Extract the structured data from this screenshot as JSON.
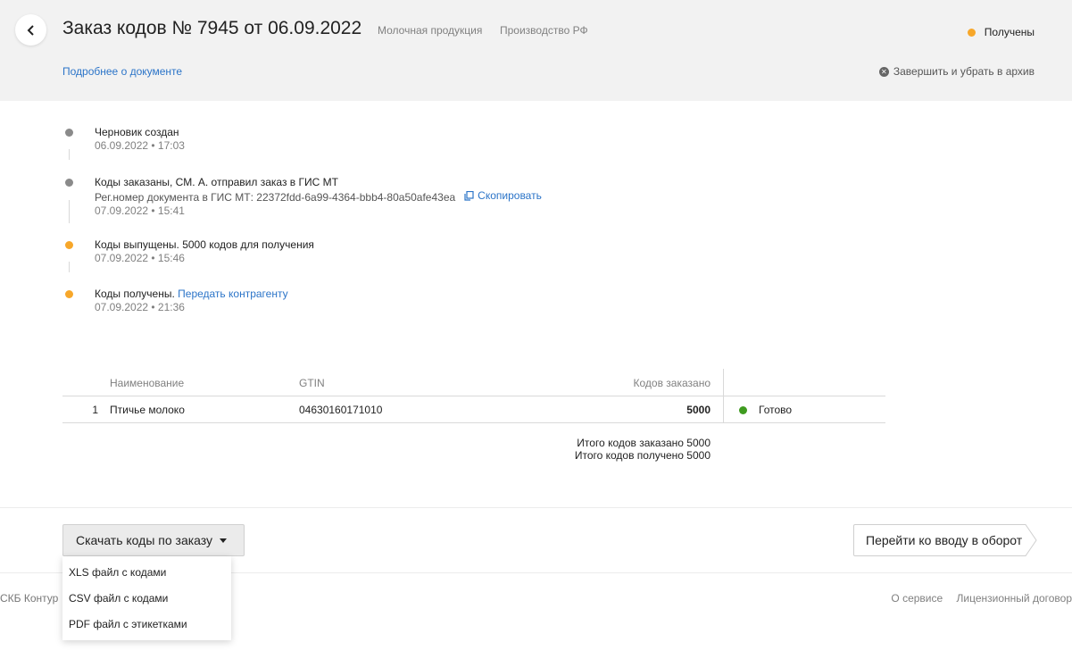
{
  "header": {
    "title": "Заказ кодов № 7945 от 06.09.2022",
    "tags": [
      "Молочная продукция",
      "Производство РФ"
    ],
    "status": "Получены",
    "status_color": "#f7a72a",
    "details_link": "Подробнее о документе",
    "archive_action": "Завершить и убрать в архив"
  },
  "timeline": [
    {
      "title": "Черновик создан",
      "time": "06.09.2022 • 17:03",
      "color": "#8a8a8a"
    },
    {
      "title": "Коды заказаны, СМ. А. отправил заказ в ГИС МТ",
      "sub": "Рег.номер документа в ГИС МТ: 22372fdd-6a99-4364-bbb4-80a50afe43ea",
      "copy_label": "Скопировать",
      "time": "07.09.2022 • 15:41",
      "color": "#8a8a8a"
    },
    {
      "title": "Коды выпущены. 5000 кодов для получения",
      "time": "07.09.2022 • 15:46",
      "color": "#f7a72a"
    },
    {
      "title": "Коды получены.",
      "link": "Передать контрагенту",
      "time": "07.09.2022 • 21:36",
      "color": "#f7a72a"
    }
  ],
  "table": {
    "headers": {
      "name": "Наименование",
      "gtin": "GTIN",
      "count": "Кодов заказано"
    },
    "rows": [
      {
        "num": "1",
        "name": "Птичье молоко",
        "gtin": "04630160171010",
        "count": "5000",
        "status": "Готово",
        "status_color": "#3f9b20"
      }
    ]
  },
  "totals": {
    "ordered_label": "Итого кодов заказано",
    "ordered_value": "5000",
    "received_label": "Итого кодов получено",
    "received_value": "5000"
  },
  "actions": {
    "download_label": "Скачать коды по заказу",
    "goto_label": "Перейти ко вводу в оборот"
  },
  "dropdown": {
    "items": [
      "XLS файл с кодами",
      "CSV файл с кодами",
      "PDF файл с этикетками"
    ]
  },
  "footer": {
    "copyright": "СКБ Контур",
    "links": [
      "О сервисе",
      "Лицензионный договор"
    ]
  }
}
